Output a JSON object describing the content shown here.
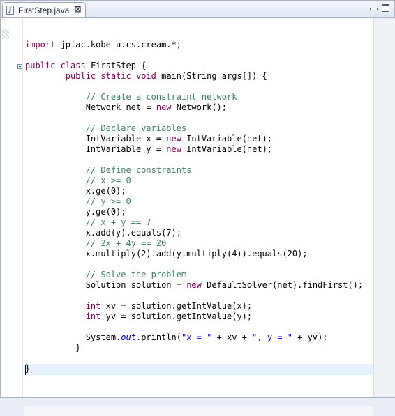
{
  "tab": {
    "title": "FirstStep.java",
    "icon": "J",
    "close_glyph": "⊠"
  },
  "code_lines": [
    "",
    "import jp.ac.kobe_u.cs.cream.*;",
    "",
    "public class FirstStep {",
    "        public static void main(String args[]) {",
    "",
    "            // Create a constraint network",
    "            Network net = new Network();",
    "",
    "            // Declare variables",
    "            IntVariable x = new IntVariable(net);",
    "            IntVariable y = new IntVariable(net);",
    "",
    "            // Define constraints",
    "            // x >= 0",
    "            x.ge(0);",
    "            // y >= 0",
    "            y.ge(0);",
    "            // x + y == 7",
    "            x.add(y).equals(7);",
    "            // 2x + 4y == 20",
    "            x.multiply(2).add(y.multiply(4)).equals(20);",
    "",
    "            // Solve the problem",
    "            Solution solution = new DefaultSolver(net).findFirst();",
    "",
    "            int xv = solution.getIntValue(x);",
    "            int yv = solution.getIntValue(y);",
    "",
    "            System.out.println(\"x = \" + xv + \", y = \" + yv);",
    "          }",
    "",
    "}",
    ""
  ],
  "colors": {
    "keyword": "#7f0055",
    "comment": "#3f7f5f",
    "string": "#2a00ff",
    "field": "#0000c0",
    "current_line": "#e8f2fe"
  },
  "icons": {
    "tab_file": "java-file-icon",
    "tab_close": "close-icon",
    "minimize": "minimize-icon",
    "maximize": "maximize-icon",
    "fold": "fold-collapse-icon"
  }
}
